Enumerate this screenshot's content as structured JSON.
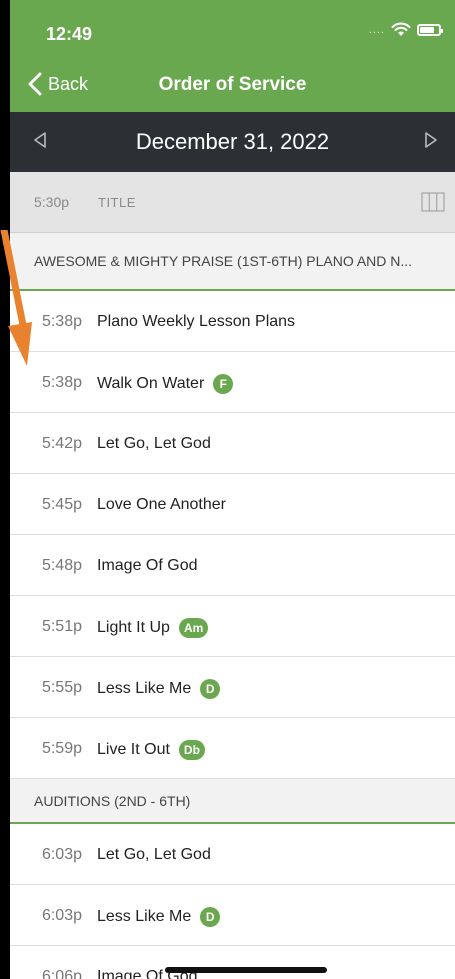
{
  "status_bar": {
    "time": "12:49",
    "signal_dots": "....",
    "wifi_icon": "wifi-icon",
    "battery_icon": "battery-icon"
  },
  "nav": {
    "back_label": "Back",
    "title": "Order of Service"
  },
  "date_bar": {
    "date": "December 31, 2022",
    "prev_icon": "triangle-left-icon",
    "next_icon": "triangle-right-icon"
  },
  "title_row": {
    "time": "5:30p",
    "label": "TITLE",
    "icon": "columns-icon"
  },
  "section1": {
    "header": "AWESOME & MIGHTY PRAISE (1ST-6TH) PLANO AND N...",
    "items": [
      {
        "time": "5:38p",
        "title": "Plano Weekly Lesson Plans",
        "key": ""
      },
      {
        "time": "5:38p",
        "title": "Walk On Water",
        "key": "F"
      },
      {
        "time": "5:42p",
        "title": "Let Go, Let God",
        "key": ""
      },
      {
        "time": "5:45p",
        "title": "Love One Another",
        "key": ""
      },
      {
        "time": "5:48p",
        "title": "Image Of God",
        "key": ""
      },
      {
        "time": "5:51p",
        "title": "Light It Up",
        "key": "Am"
      },
      {
        "time": "5:55p",
        "title": "Less Like Me",
        "key": "D"
      },
      {
        "time": "5:59p",
        "title": "Live It Out",
        "key": "Db"
      }
    ]
  },
  "section2": {
    "header": "AUDITIONS (2ND - 6TH)",
    "items": [
      {
        "time": "6:03p",
        "title": "Let Go, Let God",
        "key": ""
      },
      {
        "time": "6:03p",
        "title": "Less Like Me",
        "key": "D"
      },
      {
        "time": "6:06p",
        "title": "Image Of God",
        "key": ""
      }
    ]
  },
  "colors": {
    "brand_green": "#6aa84f",
    "date_bar": "#2c2f33",
    "annotation_arrow": "#e8822f"
  }
}
